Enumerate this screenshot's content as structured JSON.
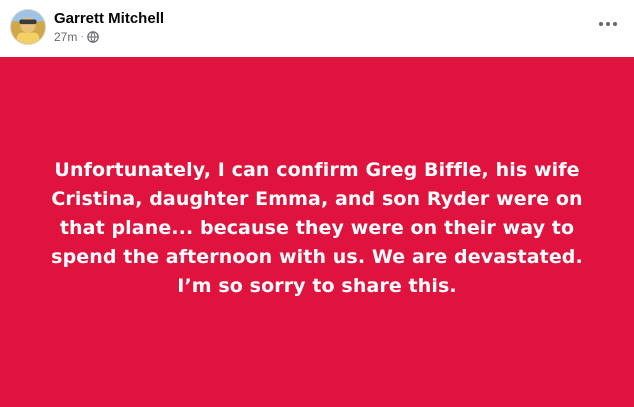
{
  "post": {
    "author": "Garrett Mitchell",
    "time": "27m",
    "separator": "·",
    "privacy_icon": "globe-icon",
    "more_icon": "more-options-icon",
    "text": "Unfortunately, I can confirm Greg Biffle, his wife Cristina, daughter Emma, and son Ryder were on that plane... because they were on their way to spend the afternoon with us. We are devastated. I’m so sorry to share this.",
    "background_color": "#e0133e",
    "text_color": "#ffffff"
  }
}
